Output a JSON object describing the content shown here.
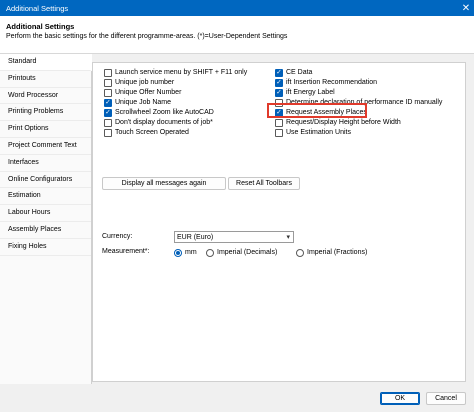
{
  "window": {
    "title": "Additional Settings",
    "close_glyph": "✕"
  },
  "header": {
    "title": "Additional Settings",
    "subtitle": "Perform the basic settings for the different programme-areas. (*)=User-Dependent Settings"
  },
  "sidebar": {
    "tabs": [
      "Standard",
      "Printouts",
      "Word Processor",
      "Printing Problems",
      "Print Options",
      "Project Comment Text",
      "Interfaces",
      "Online Configurators",
      "Estimation",
      "Labour Hours",
      "Assembly Places",
      "Fixing Holes"
    ],
    "active": "Standard"
  },
  "options_left": [
    {
      "label": "Launch service menu by SHIFT + F11 only",
      "checked": false
    },
    {
      "label": "Unique job number",
      "checked": false
    },
    {
      "label": "Unique Offer Number",
      "checked": false
    },
    {
      "label": "Unique Job Name",
      "checked": true
    },
    {
      "label": "Scrollwheel Zoom like AutoCAD",
      "checked": true
    },
    {
      "label": "Don't display documents of job*",
      "checked": false
    },
    {
      "label": "Touch Screen Operated",
      "checked": false
    }
  ],
  "options_right": [
    {
      "label": "CE Data",
      "checked": true
    },
    {
      "label": "ift Insertion Recommendation",
      "checked": true
    },
    {
      "label": "ift Energy Label",
      "checked": true
    },
    {
      "label": "Determine declaration of performance ID manually",
      "checked": false
    },
    {
      "label": "Request Assembly Places",
      "checked": true
    },
    {
      "label": "Request/Display Height before Width",
      "checked": false
    },
    {
      "label": "Use Estimation Units",
      "checked": false
    }
  ],
  "buttons": {
    "display_messages": "Display all messages again",
    "reset_toolbars": "Reset All Toolbars"
  },
  "currency": {
    "label": "Currency:",
    "value": "EUR (Euro)"
  },
  "measurement": {
    "label": "Measurement*:",
    "options": [
      "mm",
      "Imperial (Decimals)",
      "Imperial (Fractions)"
    ],
    "selected": "mm"
  },
  "footer": {
    "ok": "OK",
    "cancel": "Cancel"
  }
}
